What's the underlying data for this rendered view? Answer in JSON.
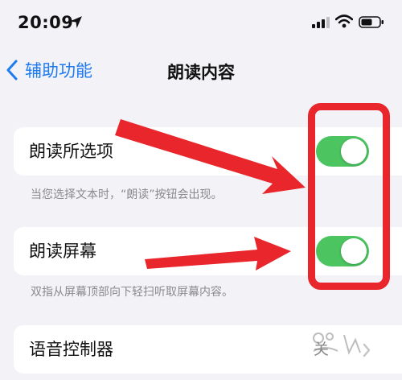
{
  "status_bar": {
    "time": "20:09"
  },
  "nav": {
    "back_label": "辅助功能",
    "title": "朗读内容"
  },
  "speak_selection": {
    "label": "朗读所选项",
    "enabled": true,
    "footer": "当您选择文本时，“朗读”按钮会出现。"
  },
  "speak_screen": {
    "label": "朗读屏幕",
    "enabled": true,
    "footer": "双指从屏幕顶部向下轻扫听取屏幕内容。"
  },
  "speech_controller": {
    "label": "语音控制器",
    "value": "关"
  },
  "colors": {
    "accent": "#1e7bf0",
    "toggle_on": "#4cc561",
    "annotation": "#e8262b",
    "background": "#f2f2f7"
  }
}
